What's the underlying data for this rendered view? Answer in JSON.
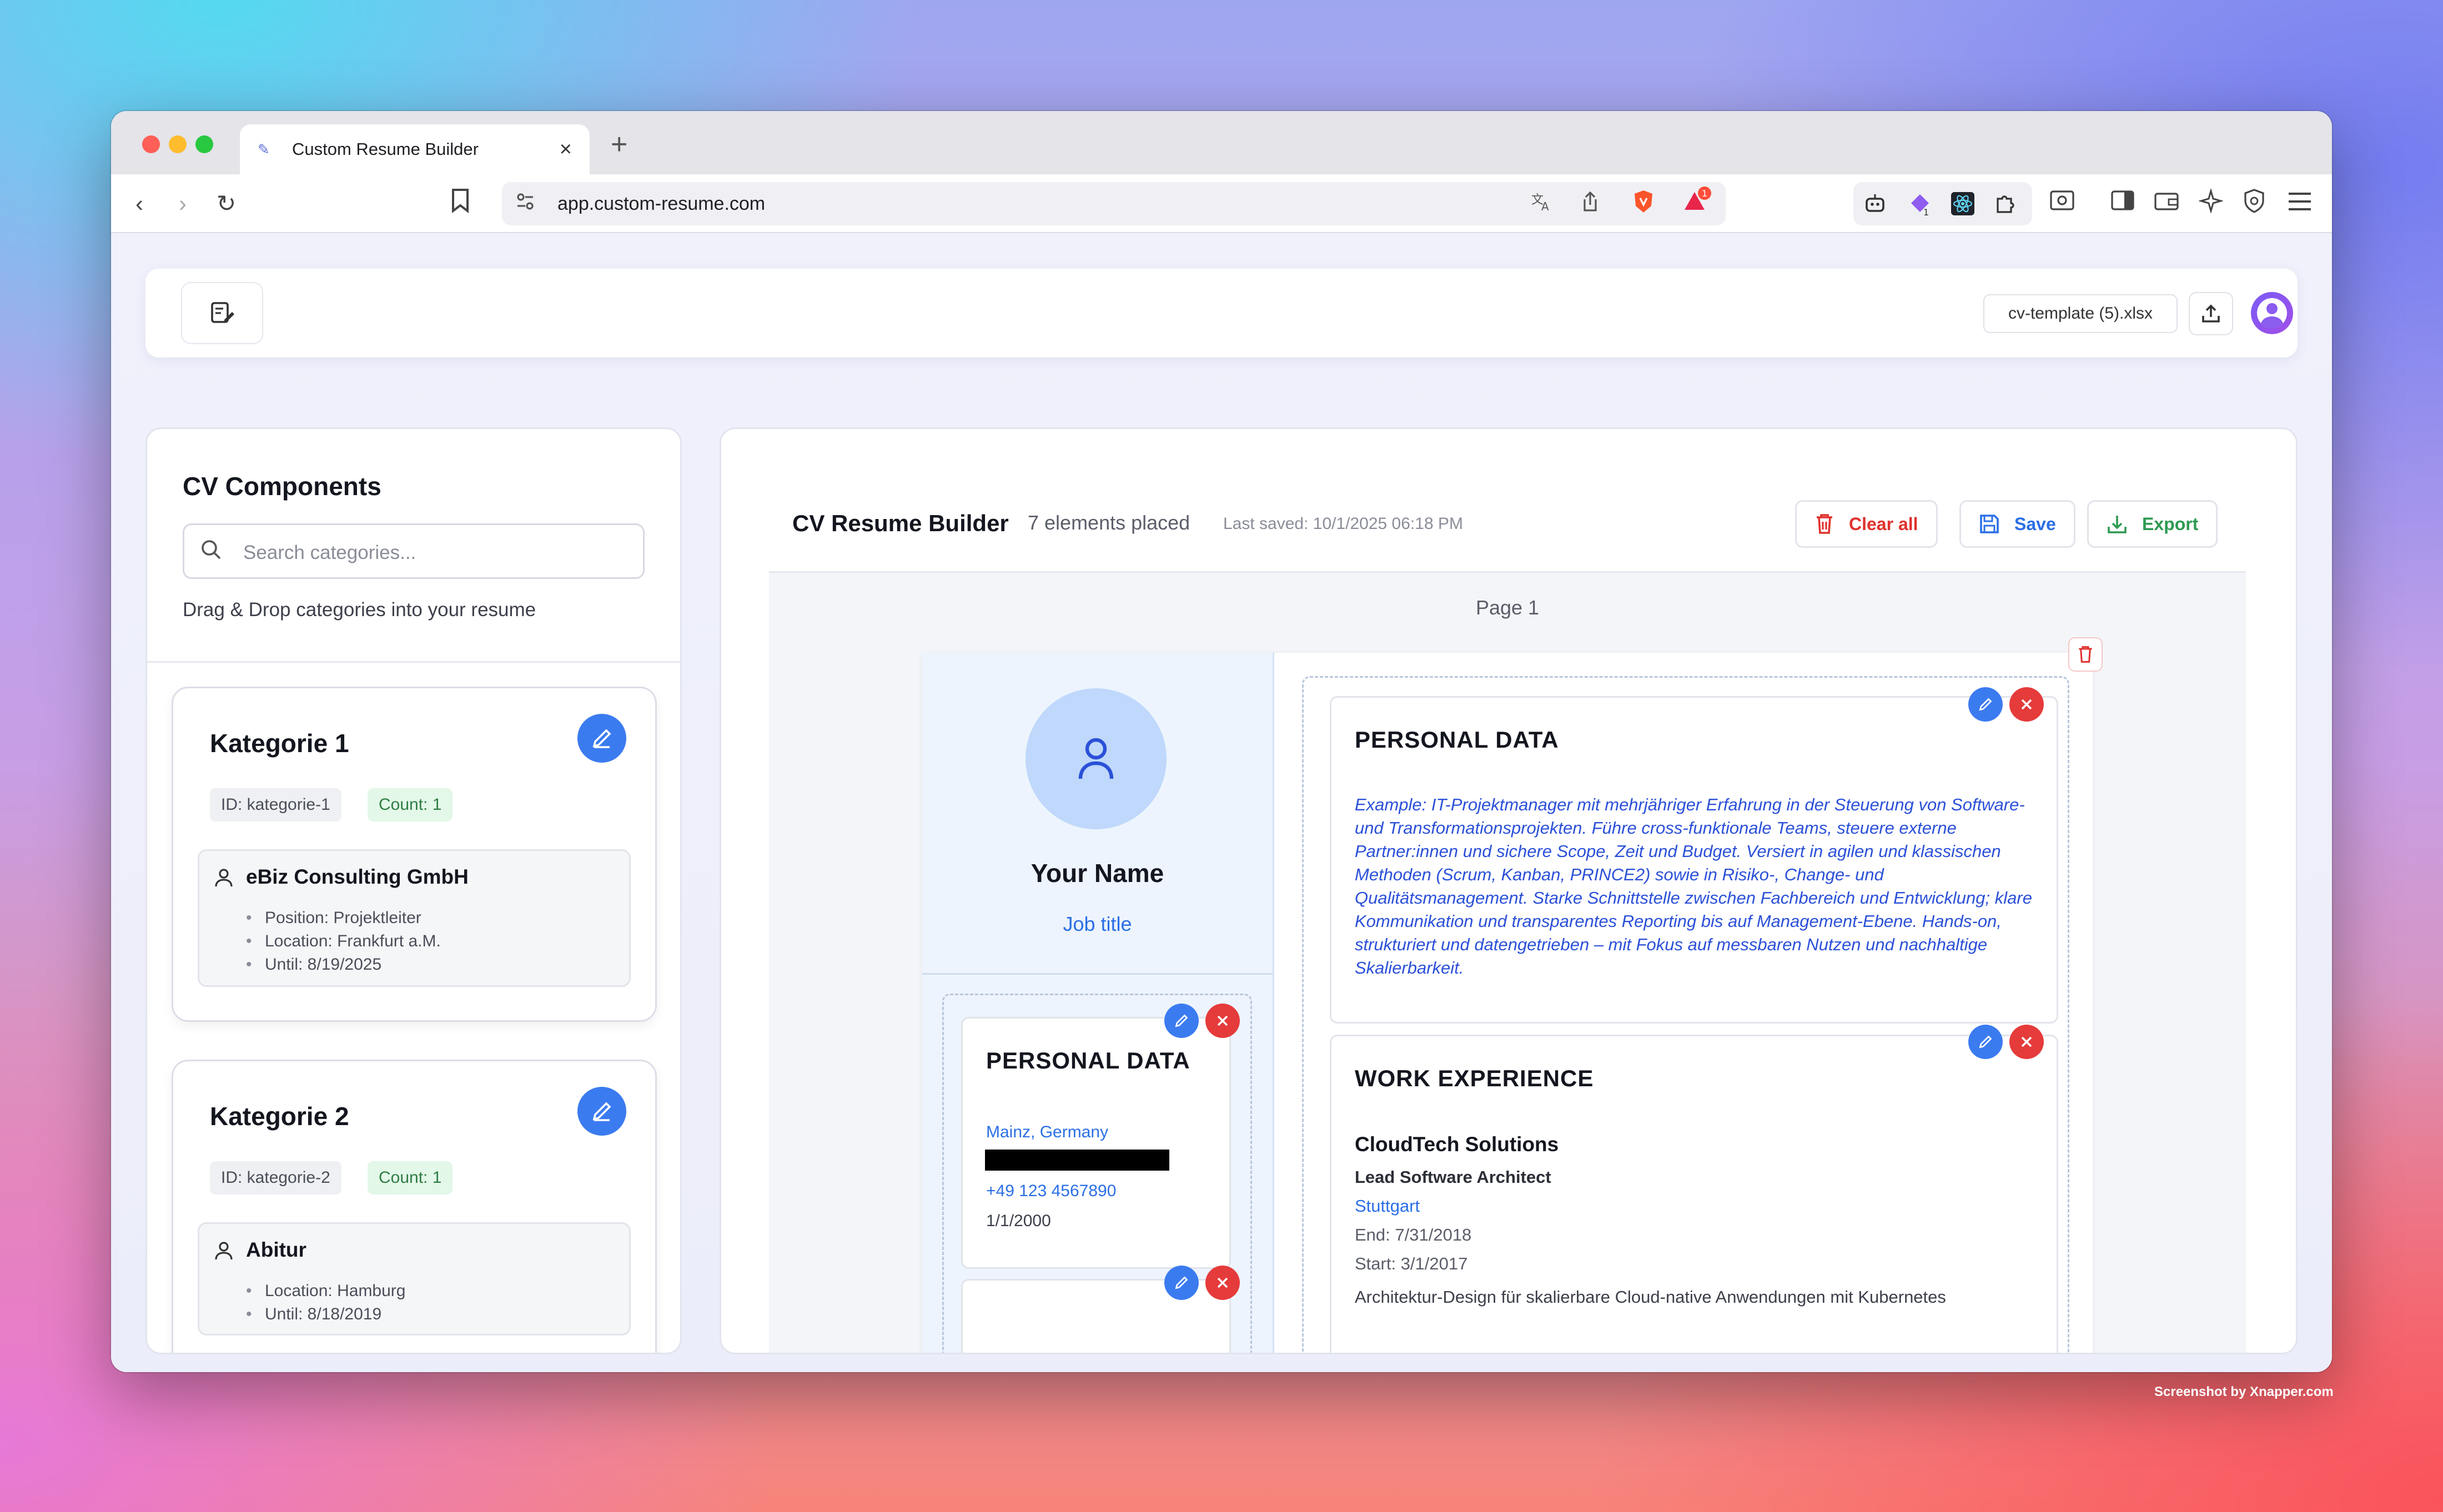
{
  "browser": {
    "tab_title": "Custom Resume Builder",
    "new_tab_label": "+",
    "url": "app.custom-resume.com",
    "notification_count": "1",
    "extension_badge": "1"
  },
  "app": {
    "file_name": "cv-template (5).xlsx"
  },
  "left_panel": {
    "title": "CV Components",
    "search_placeholder": "Search categories...",
    "hint": "Drag & Drop categories into your resume",
    "categories": [
      {
        "title": "Kategorie 1",
        "id_label": "ID: kategorie-1",
        "count_label": "Count: 1",
        "entry_title": "eBiz Consulting GmbH",
        "details": [
          "Position: Projektleiter",
          "Location: Frankfurt a.M.",
          "Until: 8/19/2025"
        ]
      },
      {
        "title": "Kategorie 2",
        "id_label": "ID: kategorie-2",
        "count_label": "Count: 1",
        "entry_title": "Abitur",
        "details": [
          "Location: Hamburg",
          "Until: 8/18/2019"
        ]
      }
    ]
  },
  "builder": {
    "title": "CV Resume Builder",
    "elements_placed": "7 elements placed",
    "last_saved": "Last saved: 10/1/2025 06:18 PM",
    "clear_label": "Clear all",
    "save_label": "Save",
    "export_label": "Export",
    "page_label": "Page 1"
  },
  "resume": {
    "name": "Your Name",
    "job_title": "Job title",
    "sidebar_block": {
      "title": "PERSONAL DATA",
      "location": "Mainz, Germany",
      "phone": "+49 123 4567890",
      "date": "1/1/2000"
    },
    "summary_block": {
      "title": "PERSONAL DATA",
      "text": "Example: IT-Projektmanager mit mehrjähriger Erfahrung in der Steuerung von Software- und Transformationsprojekten. Führe cross-funktionale Teams, steuere externe Partner:innen und sichere Scope, Zeit und Budget. Versiert in agilen und klassischen Methoden (Scrum, Kanban, PRINCE2) sowie in Risiko-, Change- und Qualitätsmanagement. Starke Schnittstelle zwischen Fachbereich und Entwicklung; klare Kommunikation und transparentes Reporting bis auf Management-Ebene. Hands-on, strukturiert und datengetrieben – mit Fokus auf messbaren Nutzen und nachhaltige Skalierbarkeit."
    },
    "experience_block": {
      "title": "WORK EXPERIENCE",
      "company": "CloudTech Solutions",
      "role": "Lead Software Architect",
      "city": "Stuttgart",
      "end": "End: 7/31/2018",
      "start": "Start: 3/1/2017",
      "description": "Architektur-Design für skalierbare Cloud-native Anwendungen mit Kubernetes"
    }
  },
  "footer": {
    "credit": "Screenshot by Xnapper.com"
  },
  "colors": {
    "accent_blue": "#3b7bf0",
    "danger_red": "#e53b3b",
    "success_green": "#2f9a52"
  }
}
